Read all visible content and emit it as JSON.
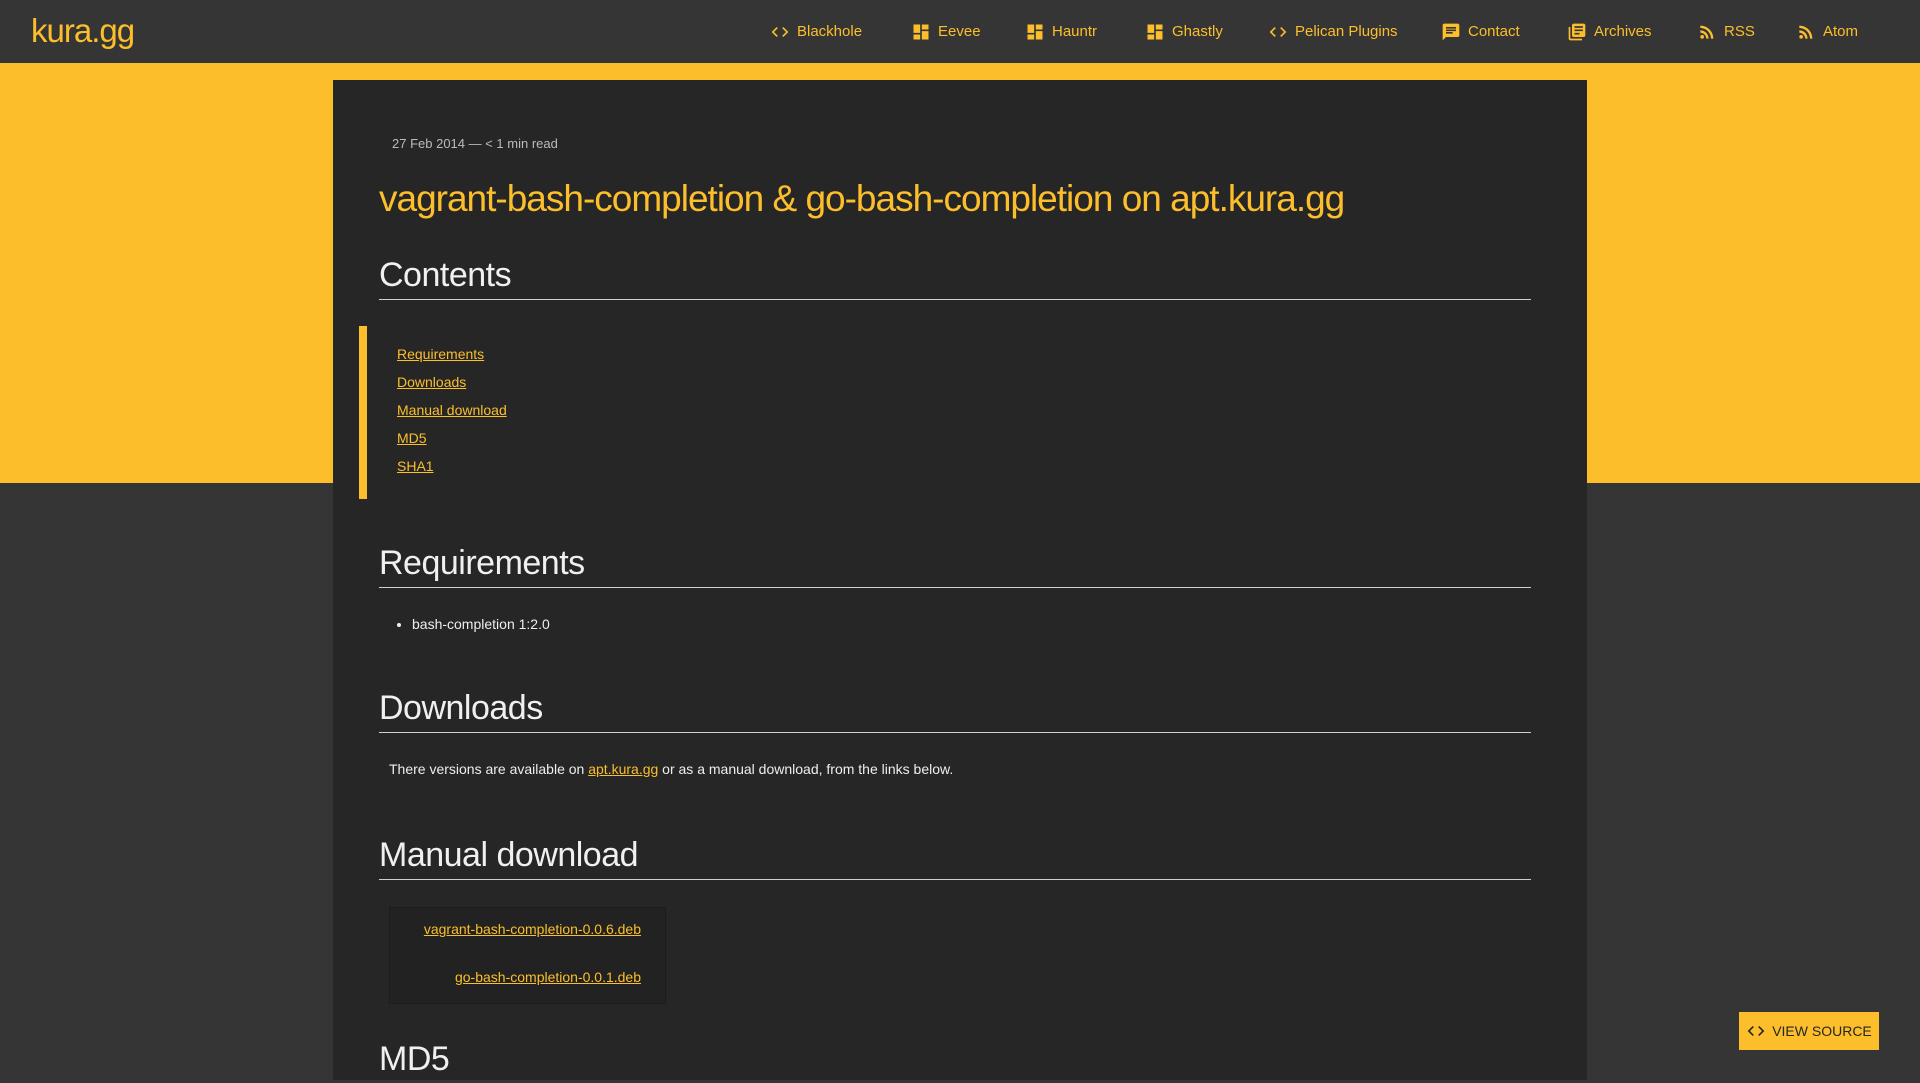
{
  "site": {
    "brand": "kura.gg"
  },
  "nav": [
    {
      "label": "Blackhole",
      "icon": "code-icon"
    },
    {
      "label": "Eevee",
      "icon": "dashboard-icon"
    },
    {
      "label": "Hauntr",
      "icon": "dashboard-icon"
    },
    {
      "label": "Ghastly",
      "icon": "dashboard-icon"
    },
    {
      "label": "Pelican Plugins",
      "icon": "code-icon"
    },
    {
      "label": "Contact",
      "icon": "chat-icon"
    },
    {
      "label": "Archives",
      "icon": "library-icon"
    },
    {
      "label": "RSS",
      "icon": "rss-icon"
    },
    {
      "label": "Atom",
      "icon": "rss-icon"
    }
  ],
  "article": {
    "meta": "27 Feb 2014 — < 1 min read",
    "title": "vagrant-bash-completion & go-bash-completion on apt.kura.gg",
    "contents_heading": "Contents",
    "toc": [
      "Requirements",
      "Downloads",
      "Manual download",
      "MD5",
      "SHA1"
    ],
    "requirements_heading": "Requirements",
    "requirements": [
      "bash-completion 1:2.0"
    ],
    "downloads_heading": "Downloads",
    "downloads_text_before": "There versions are available on ",
    "downloads_link": "apt.kura.gg",
    "downloads_text_after": " or as a manual download, from the links below.",
    "manual_heading": "Manual download",
    "manual_links": [
      "vagrant-bash-completion-0.0.6.deb",
      "go-bash-completion-0.0.1.deb"
    ],
    "md5_heading": "MD5"
  },
  "view_source": {
    "label": "VIEW SOURCE",
    "icon": "code-icon"
  },
  "colors": {
    "accent": "#fcbf2b",
    "background": "#353535",
    "card": "#262626"
  }
}
